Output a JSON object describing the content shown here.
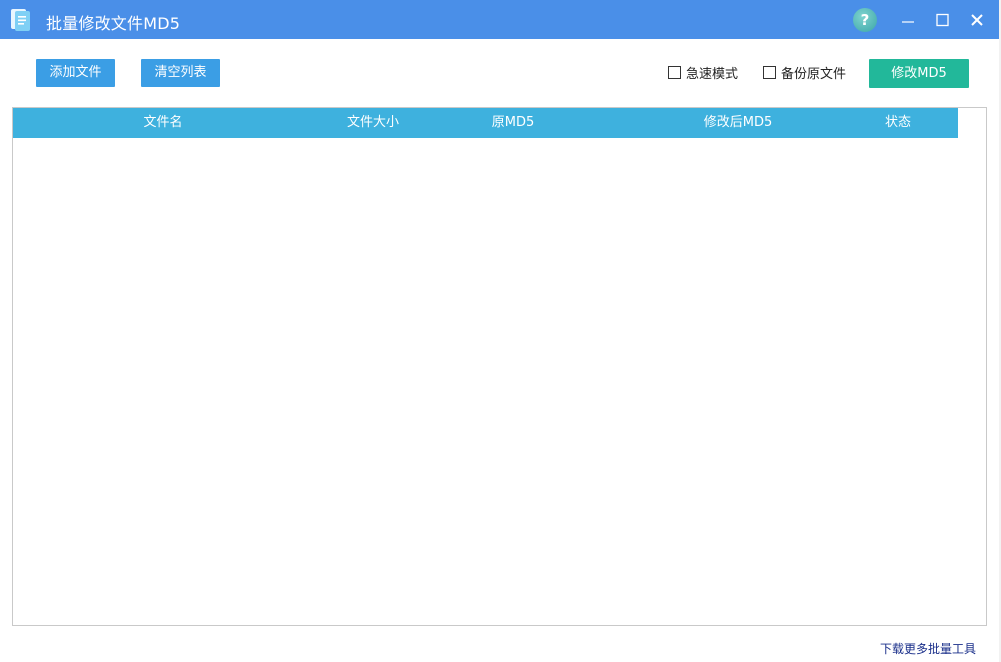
{
  "window": {
    "title": "批量修改文件MD5",
    "colors": {
      "titlebar": "#4a8fe8",
      "accent_blue": "#3b9ee5",
      "accent_green": "#22b89a",
      "header": "#3eb1de"
    },
    "controls": {
      "help_icon": "help-icon",
      "minimize_icon": "minimize-icon",
      "maximize_icon": "maximize-icon",
      "close_icon": "close-icon"
    }
  },
  "toolbar": {
    "add_label": "添加文件",
    "clear_label": "清空列表",
    "fast_mode_label": "急速模式",
    "fast_mode_checked": false,
    "backup_label": "备份原文件",
    "backup_checked": false,
    "modify_label": "修改MD5"
  },
  "table": {
    "columns": [
      "文件名",
      "文件大小",
      "原MD5",
      "修改后MD5",
      "状态"
    ],
    "rows": []
  },
  "footer": {
    "link_label": "下载更多批量工具"
  }
}
